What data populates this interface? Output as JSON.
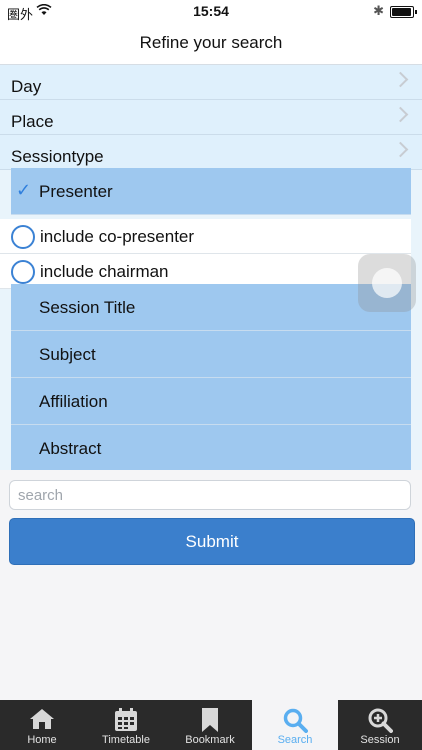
{
  "status": {
    "carrier": "圏外",
    "time": "15:54"
  },
  "nav": {
    "title": "Refine your search"
  },
  "filters": [
    {
      "label": "Day"
    },
    {
      "label": "Place"
    },
    {
      "label": "Sessiontype"
    }
  ],
  "fields": {
    "presenter": "Presenter",
    "co_presenter": "include co-presenter",
    "chairman": "include chairman",
    "session_title": "Session Title",
    "subject": "Subject",
    "affiliation": "Affiliation",
    "abstract": "Abstract"
  },
  "search": {
    "placeholder": "search",
    "value": ""
  },
  "submit_label": "Submit",
  "tabs": [
    {
      "label": "Home",
      "icon": "home-icon"
    },
    {
      "label": "Timetable",
      "icon": "calendar-icon"
    },
    {
      "label": "Bookmark",
      "icon": "bookmark-icon"
    },
    {
      "label": "Search",
      "icon": "search-icon",
      "active": true
    },
    {
      "label": "Session",
      "icon": "zoom-in-icon"
    }
  ],
  "colors": {
    "accent": "#3b7fcc",
    "selected_row": "#9ec8ef",
    "tab_active": "#5aaef0",
    "tab_bar": "#2a2a2a"
  }
}
